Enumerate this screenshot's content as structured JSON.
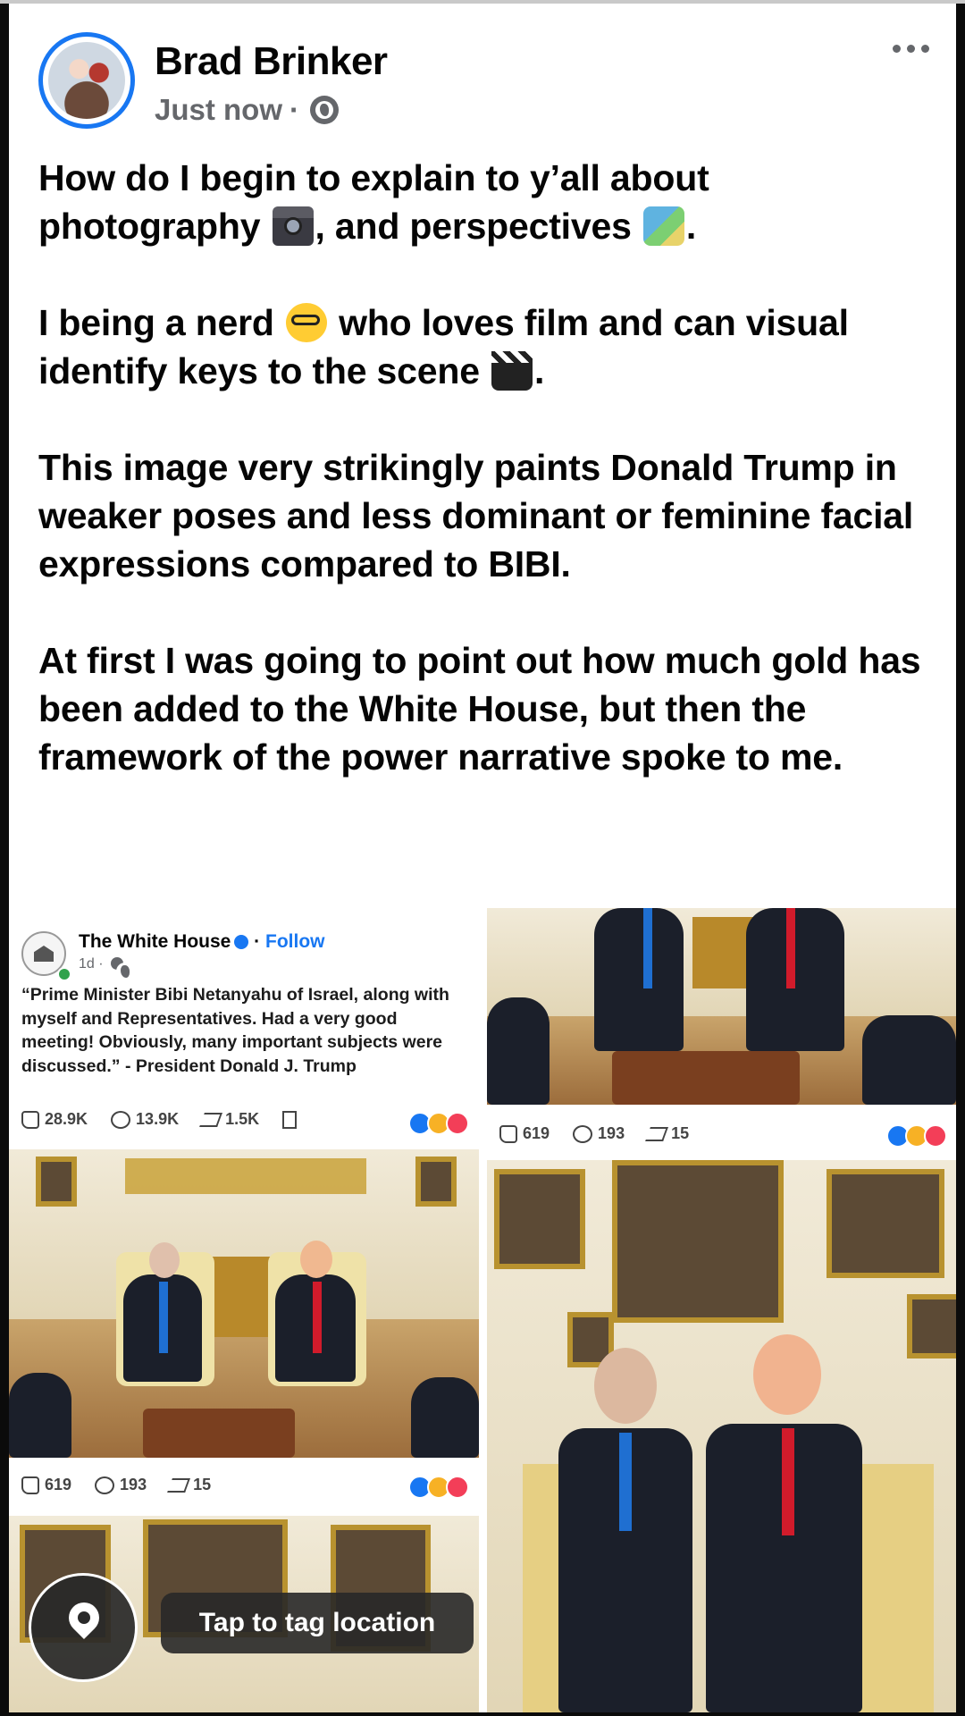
{
  "post": {
    "author": "Brad Brinker",
    "time": "Just now",
    "separator": "·",
    "privacy_icon": "globe-icon",
    "paragraphs": [
      {
        "before": "How do I begin to explain to y’all about photography ",
        "emoji1": "camera-flash-emoji",
        "middle": ", and perspectives ",
        "emoji2": "world-map-emoji",
        "after": "."
      },
      {
        "before": "I being a nerd ",
        "emoji1": "nerd-face-emoji",
        "middle": " who loves film and can visual identify keys to the scene ",
        "emoji2": "clapper-board-emoji",
        "after": "."
      },
      {
        "text": "This image very strikingly paints Donald Trump in weaker poses and less dominant or feminine facial expressions compared to BIBI."
      },
      {
        "text": "At first I was going to point out how much gold has been added to the White House, but then the framework of the power narrative spoke to me."
      }
    ]
  },
  "embedded_post": {
    "name": "The White House",
    "follow": "Follow",
    "time": "1d ·",
    "quote": "“Prime Minister Bibi Netanyahu of Israel, along with myself and Representatives. Had a very good meeting! Obviously, many important subjects were discussed.” - President Donald J. Trump",
    "likes": "28.9K",
    "comments": "13.9K",
    "shares": "1.5K"
  },
  "photo_stats": {
    "likes": "619",
    "comments": "193",
    "shares": "15"
  },
  "location": {
    "label": "Tap to tag location",
    "icon": "location-pin-icon"
  },
  "colors": {
    "accent": "#1877f2",
    "text": "#050505",
    "secondary": "#65676b"
  }
}
